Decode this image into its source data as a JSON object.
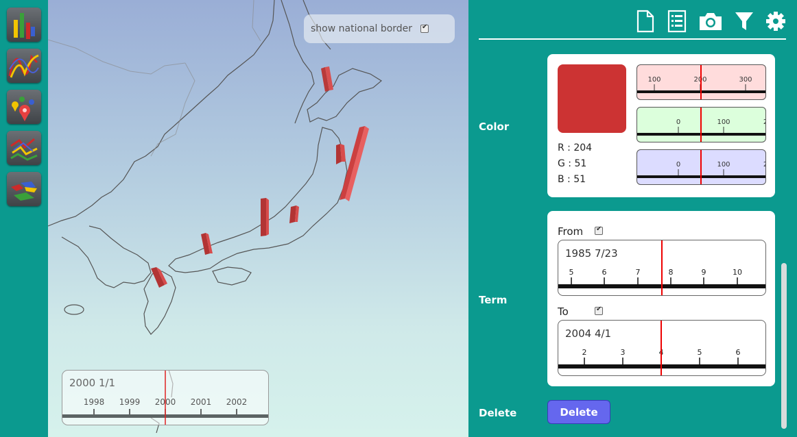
{
  "tools": [
    {
      "name": "bar-chart-tool-icon"
    },
    {
      "name": "line-chart-tool-icon"
    },
    {
      "name": "map-pins-tool-icon"
    },
    {
      "name": "path-tool-icon"
    },
    {
      "name": "region-tool-icon"
    }
  ],
  "map": {
    "border_toggle_label": "show national border",
    "border_toggle_checked": true,
    "timeline": {
      "value": "2000 1/1",
      "ticks": [
        "1998",
        "1999",
        "2000",
        "2001",
        "2002"
      ]
    }
  },
  "toolbar": {
    "icons": [
      "new-file-icon",
      "list-icon",
      "camera-icon",
      "filter-icon",
      "settings-icon"
    ]
  },
  "color": {
    "label": "Color",
    "swatch": "#cc3333",
    "r_text": "R : 204",
    "g_text": "G : 51",
    "b_text": "B : 51",
    "r_ticks": [
      "100",
      "200",
      "300"
    ],
    "g_ticks": [
      "0",
      "100",
      "2"
    ],
    "b_ticks": [
      "0",
      "100",
      "2"
    ]
  },
  "term": {
    "label": "Term",
    "from_label": "From",
    "from_value": "1985 7/23",
    "from_ticks": [
      "5",
      "6",
      "7",
      "8",
      "9",
      "10"
    ],
    "to_label": "To",
    "to_value": "2004 4/1",
    "to_ticks": [
      "2",
      "3",
      "4",
      "5",
      "6"
    ]
  },
  "delete": {
    "label": "Delete",
    "button_label": "Delete"
  },
  "accent": "#0b9a8f"
}
